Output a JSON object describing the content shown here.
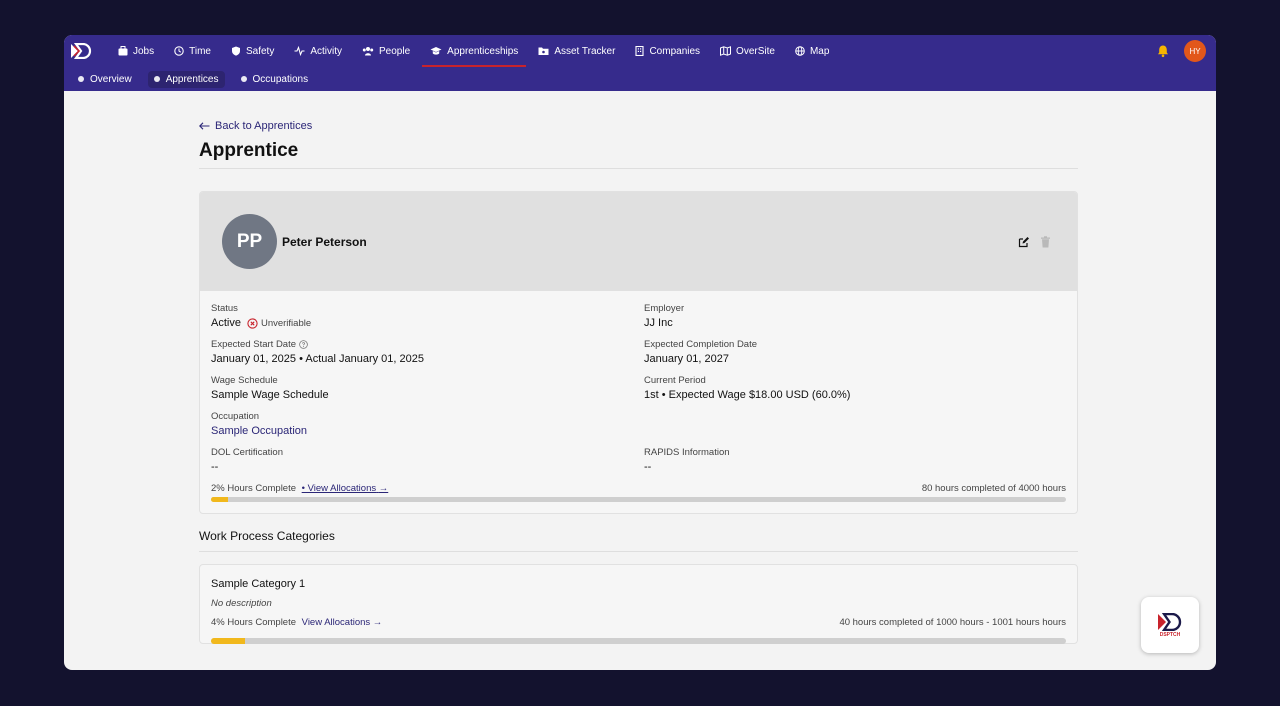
{
  "nav": {
    "items": [
      {
        "label": "Jobs",
        "icon": "briefcase-icon"
      },
      {
        "label": "Time",
        "icon": "clock-icon"
      },
      {
        "label": "Safety",
        "icon": "shield-icon"
      },
      {
        "label": "Activity",
        "icon": "activity-icon"
      },
      {
        "label": "People",
        "icon": "people-icon"
      },
      {
        "label": "Apprenticeships",
        "icon": "graduation-cap-icon"
      },
      {
        "label": "Asset Tracker",
        "icon": "folder-icon"
      },
      {
        "label": "Companies",
        "icon": "building-icon"
      },
      {
        "label": "OverSite",
        "icon": "map-icon"
      },
      {
        "label": "Map",
        "icon": "globe-icon"
      }
    ],
    "active": "Apprenticeships",
    "user_initials": "HY"
  },
  "subnav": {
    "items": [
      {
        "label": "Overview"
      },
      {
        "label": "Apprentices"
      },
      {
        "label": "Occupations"
      }
    ],
    "active": "Apprentices"
  },
  "page": {
    "back_label": "Back to Apprentices",
    "title": "Apprentice"
  },
  "apprentice": {
    "initials": "PP",
    "name": "Peter Peterson",
    "fields": {
      "status_label": "Status",
      "status_value": "Active",
      "status_badge": "Unverifiable",
      "employer_label": "Employer",
      "employer_value": "JJ Inc",
      "start_label": "Expected Start Date",
      "start_value": "January 01, 2025 • Actual January 01, 2025",
      "completion_label": "Expected Completion Date",
      "completion_value": "January 01, 2027",
      "wage_label": "Wage Schedule",
      "wage_value": "Sample Wage Schedule",
      "period_label": "Current Period",
      "period_value": "1st • Expected Wage $18.00 USD (60.0%)",
      "occupation_label": "Occupation",
      "occupation_value": "Sample Occupation",
      "dol_label": "DOL Certification",
      "dol_value": "--",
      "rapids_label": "RAPIDS Information",
      "rapids_value": "--"
    },
    "progress": {
      "text": "2% Hours Complete",
      "link": "• View Allocations",
      "summary": "80 hours completed of 4000 hours",
      "fraction": 0.02
    }
  },
  "work_process": {
    "section_title": "Work Process Categories",
    "categories": [
      {
        "title": "Sample Category 1",
        "description": "No description",
        "progress_text": "4% Hours Complete",
        "link": "View Allocations",
        "summary": "40 hours completed of 1000 hours - 1001 hours hours",
        "fraction": 0.04
      }
    ]
  },
  "widget": {
    "label": "DSPTCH"
  },
  "colors": {
    "nav_bg": "#362b8c",
    "accent_red": "#c8232c",
    "progress_fill": "#f1b81c",
    "link": "#2b2677"
  }
}
